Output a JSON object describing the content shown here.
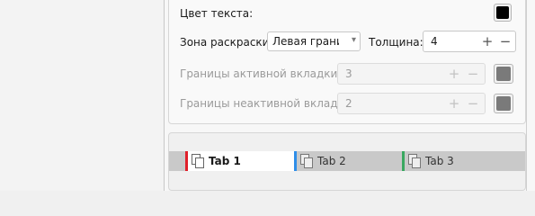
{
  "settings": {
    "text_color_label": "Цвет текста:",
    "text_color": "#000000",
    "coloring_zone_label": "Зона раскраски:",
    "coloring_zone_value": "Левая границ",
    "thickness_label": "Толщина:",
    "thickness_value": "4",
    "active_border_label": "Границы активной вкладки:",
    "active_border_value": "3",
    "active_border_color": "#7a7a7a",
    "inactive_border_label": "Границы неактивной вкладки:",
    "inactive_border_value": "2",
    "inactive_border_color": "#7a7a7a"
  },
  "preview": {
    "tabs": [
      {
        "label": "Tab 1",
        "color": "#e0202a",
        "active": true
      },
      {
        "label": "Tab 2",
        "color": "#2f8ee8",
        "active": false
      },
      {
        "label": "Tab 3",
        "color": "#3aa860",
        "active": false
      }
    ]
  },
  "icons": {
    "plus": "+",
    "minus": "−",
    "dropdown": "▾"
  }
}
